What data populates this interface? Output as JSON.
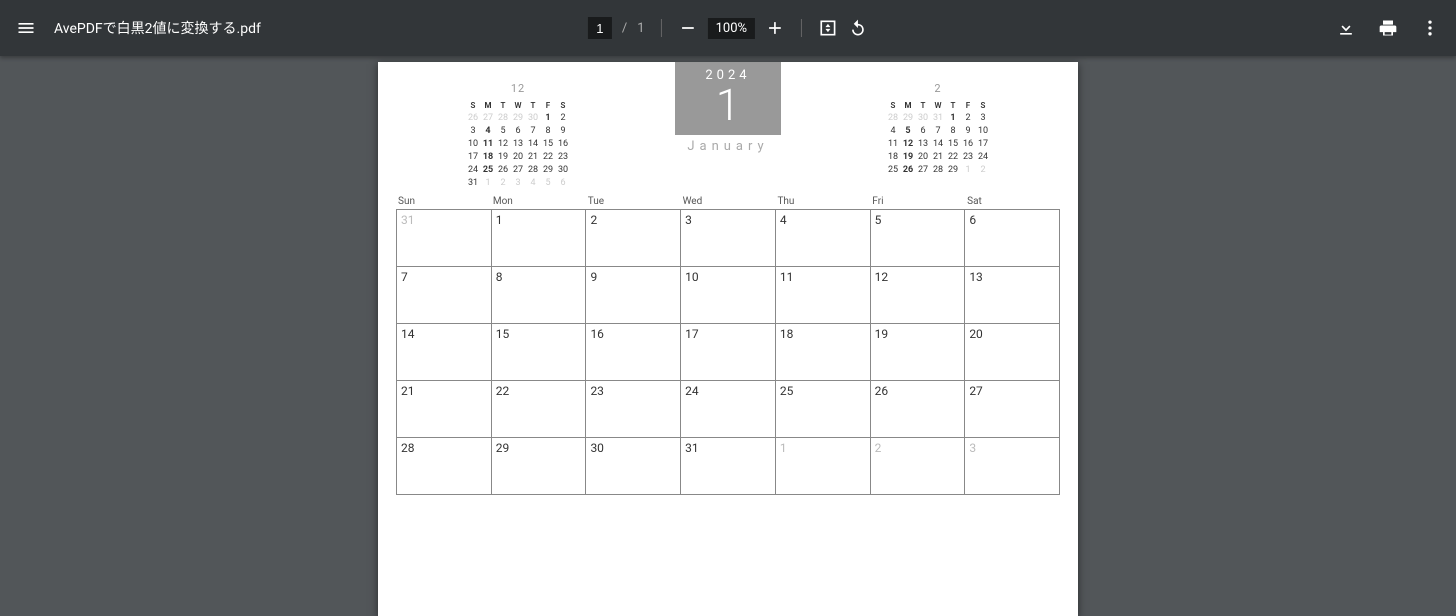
{
  "toolbar": {
    "doc_title": "AvePDFで白黒2値に変換する.pdf",
    "page_current": "1",
    "page_sep": "/",
    "page_total": "1",
    "zoom": "100%"
  },
  "calendar": {
    "year": "2024",
    "month_num": "1",
    "month_name": "January",
    "mini_prev": {
      "title": "12",
      "dow": [
        "S",
        "M",
        "T",
        "W",
        "T",
        "F",
        "S"
      ],
      "rows": [
        [
          {
            "v": "26",
            "d": 1
          },
          {
            "v": "27",
            "d": 1
          },
          {
            "v": "28",
            "d": 1
          },
          {
            "v": "29",
            "d": 1
          },
          {
            "v": "30",
            "d": 1
          },
          {
            "v": "1",
            "b": 1
          },
          {
            "v": "2"
          }
        ],
        [
          {
            "v": "3"
          },
          {
            "v": "4",
            "b": 1
          },
          {
            "v": "5"
          },
          {
            "v": "6"
          },
          {
            "v": "7"
          },
          {
            "v": "8"
          },
          {
            "v": "9"
          }
        ],
        [
          {
            "v": "10"
          },
          {
            "v": "11",
            "b": 1
          },
          {
            "v": "12"
          },
          {
            "v": "13"
          },
          {
            "v": "14"
          },
          {
            "v": "15"
          },
          {
            "v": "16"
          }
        ],
        [
          {
            "v": "17"
          },
          {
            "v": "18",
            "b": 1
          },
          {
            "v": "19"
          },
          {
            "v": "20"
          },
          {
            "v": "21"
          },
          {
            "v": "22"
          },
          {
            "v": "23"
          }
        ],
        [
          {
            "v": "24"
          },
          {
            "v": "25",
            "b": 1
          },
          {
            "v": "26"
          },
          {
            "v": "27"
          },
          {
            "v": "28"
          },
          {
            "v": "29"
          },
          {
            "v": "30"
          }
        ],
        [
          {
            "v": "31"
          },
          {
            "v": "1",
            "d": 1
          },
          {
            "v": "2",
            "d": 1
          },
          {
            "v": "3",
            "d": 1
          },
          {
            "v": "4",
            "d": 1
          },
          {
            "v": "5",
            "d": 1
          },
          {
            "v": "6",
            "d": 1
          }
        ]
      ]
    },
    "mini_next": {
      "title": "2",
      "dow": [
        "S",
        "M",
        "T",
        "W",
        "T",
        "F",
        "S"
      ],
      "rows": [
        [
          {
            "v": "28",
            "d": 1
          },
          {
            "v": "29",
            "d": 1
          },
          {
            "v": "30",
            "d": 1
          },
          {
            "v": "31",
            "d": 1
          },
          {
            "v": "1",
            "b": 1
          },
          {
            "v": "2"
          },
          {
            "v": "3"
          }
        ],
        [
          {
            "v": "4"
          },
          {
            "v": "5",
            "b": 1
          },
          {
            "v": "6"
          },
          {
            "v": "7"
          },
          {
            "v": "8"
          },
          {
            "v": "9"
          },
          {
            "v": "10"
          }
        ],
        [
          {
            "v": "11"
          },
          {
            "v": "12",
            "b": 1
          },
          {
            "v": "13"
          },
          {
            "v": "14"
          },
          {
            "v": "15"
          },
          {
            "v": "16"
          },
          {
            "v": "17"
          }
        ],
        [
          {
            "v": "18"
          },
          {
            "v": "19",
            "b": 1
          },
          {
            "v": "20"
          },
          {
            "v": "21"
          },
          {
            "v": "22"
          },
          {
            "v": "23"
          },
          {
            "v": "24"
          }
        ],
        [
          {
            "v": "25"
          },
          {
            "v": "26",
            "b": 1
          },
          {
            "v": "27"
          },
          {
            "v": "28"
          },
          {
            "v": "29"
          },
          {
            "v": "1",
            "d": 1
          },
          {
            "v": "2",
            "d": 1
          }
        ]
      ]
    },
    "main": {
      "dow": [
        "Sun",
        "Mon",
        "Tue",
        "Wed",
        "Thu",
        "Fri",
        "Sat"
      ],
      "rows": [
        [
          {
            "v": "31",
            "d": 1
          },
          {
            "v": "1"
          },
          {
            "v": "2"
          },
          {
            "v": "3"
          },
          {
            "v": "4"
          },
          {
            "v": "5"
          },
          {
            "v": "6"
          }
        ],
        [
          {
            "v": "7"
          },
          {
            "v": "8"
          },
          {
            "v": "9"
          },
          {
            "v": "10"
          },
          {
            "v": "11"
          },
          {
            "v": "12"
          },
          {
            "v": "13"
          }
        ],
        [
          {
            "v": "14"
          },
          {
            "v": "15"
          },
          {
            "v": "16"
          },
          {
            "v": "17"
          },
          {
            "v": "18"
          },
          {
            "v": "19"
          },
          {
            "v": "20"
          }
        ],
        [
          {
            "v": "21"
          },
          {
            "v": "22"
          },
          {
            "v": "23"
          },
          {
            "v": "24"
          },
          {
            "v": "25"
          },
          {
            "v": "26"
          },
          {
            "v": "27"
          }
        ],
        [
          {
            "v": "28"
          },
          {
            "v": "29"
          },
          {
            "v": "30"
          },
          {
            "v": "31"
          },
          {
            "v": "1",
            "d": 1
          },
          {
            "v": "2",
            "d": 1
          },
          {
            "v": "3",
            "d": 1
          }
        ]
      ]
    }
  }
}
